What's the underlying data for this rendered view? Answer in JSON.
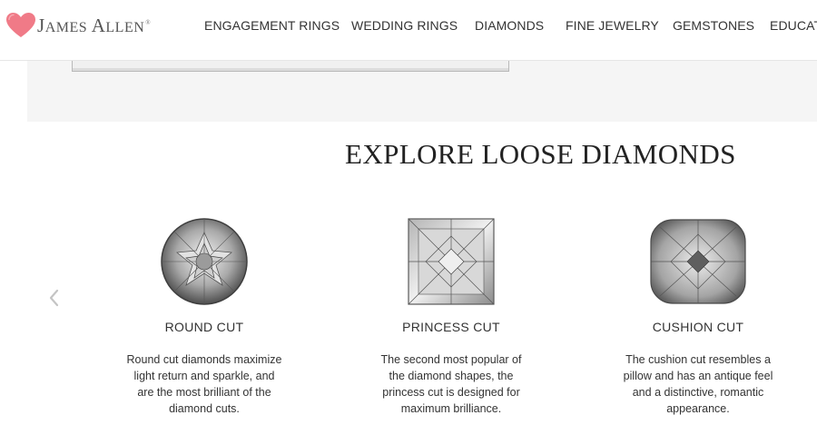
{
  "brand": {
    "name_first_initial": "J",
    "name_first_rest": "AMES",
    "name_last_initial": "A",
    "name_last_rest": "LLEN",
    "registered": "®"
  },
  "nav": [
    "ENGAGEMENT RINGS",
    "WEDDING RINGS",
    "DIAMONDS",
    "FINE JEWELRY",
    "GEMSTONES",
    "EDUCATION"
  ],
  "section": {
    "title": "EXPLORE LOOSE DIAMONDS"
  },
  "colors": {
    "heart": "#f07a87",
    "text": "#333333",
    "band": "#f5f5f5"
  },
  "cards": [
    {
      "title": "ROUND CUT",
      "icon": "round-diamond-icon",
      "desc": [
        "Round cut diamonds maximize",
        "light return and sparkle, and",
        "are the most brilliant of the",
        "diamond cuts."
      ]
    },
    {
      "title": "PRINCESS CUT",
      "icon": "princess-diamond-icon",
      "desc": [
        "The second most popular of",
        "the diamond shapes, the",
        "princess cut is designed for",
        "maximum brilliance."
      ]
    },
    {
      "title": "CUSHION CUT",
      "icon": "cushion-diamond-icon",
      "desc": [
        "The cushion cut resembles a",
        "pillow and has an antique feel",
        "and a distinctive, romantic",
        "appearance."
      ]
    }
  ],
  "carousel": {
    "prev_icon": "chevron-left-icon"
  }
}
